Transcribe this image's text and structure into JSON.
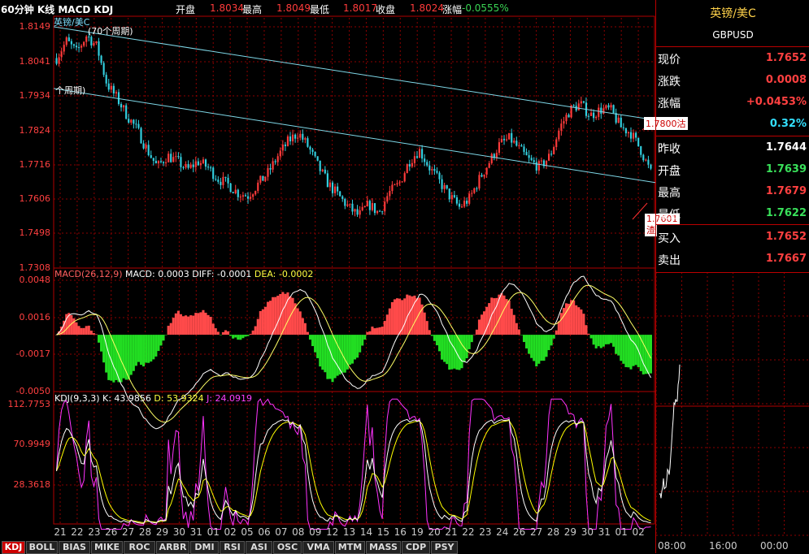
{
  "header": {
    "title": "60分钟 K线 MACD KDJ",
    "open_label": "开盘",
    "open_value": "1.8034",
    "high_label": "最高",
    "high_value": "1.8049",
    "low_label": "最低",
    "low_value": "1.8017",
    "close_label": "收盘",
    "close_value": "1.8024",
    "change_label": "涨幅",
    "change_value": "-0.0555%"
  },
  "right_panel": {
    "name": "英镑/美Ⅽ",
    "code": "GBPUSD",
    "rows": [
      {
        "label": "现价",
        "value": "1.7652",
        "color": "red"
      },
      {
        "label": "涨跌",
        "value": "0.0008",
        "color": "red"
      },
      {
        "label": "涨幅",
        "value": "+0.0453%",
        "color": "red"
      },
      {
        "label": "",
        "value": "0.32%",
        "color": "cyan"
      },
      {
        "label": "昨收",
        "value": "1.7644",
        "color": "white"
      },
      {
        "label": "开盘",
        "value": "1.7639",
        "color": "green"
      },
      {
        "label": "最高",
        "value": "1.7679",
        "color": "red"
      },
      {
        "label": "最低",
        "value": "1.7622",
        "color": "green"
      },
      {
        "label": "买入",
        "value": "1.7652",
        "color": "red"
      },
      {
        "label": "卖出",
        "value": "1.7667",
        "color": "red"
      }
    ],
    "time_axis": [
      "08:00",
      "16:00",
      "00:00"
    ]
  },
  "annotations": {
    "symbol_label": "英镑/美Ⅽ",
    "upper_trend_label": "(70个周期)",
    "lower_trend_label": "个周期)",
    "resistance_tag": "1.7800沽",
    "support_tag": "1.7601",
    "support_tag_suffix": "渣"
  },
  "macd": {
    "title": "MACD(26,12,9)",
    "macd": "MACD: 0.0003",
    "diff": "DIFF: -0.0001",
    "dea": "DEA: -0.0002"
  },
  "kdj": {
    "title": "KDJ(9,3,3)",
    "k": "K: 43.9856",
    "d": "D: 53.9324",
    "j": "J: 24.0919"
  },
  "tabs": [
    "KDJ",
    "BOLL",
    "BIAS",
    "MIKE",
    "ROC",
    "ARBR",
    "DMI",
    "RSI",
    "ASI",
    "OSC",
    "VMA",
    "MTM",
    "MASS",
    "CDP",
    "PSY"
  ],
  "active_tab": "KDJ",
  "colors": {
    "up": "#ff3b3b",
    "down": "#33d0e0",
    "grid": "#8b0000",
    "trend": "#7fd8e8",
    "macd_pos": "#ff4a4a",
    "macd_neg": "#22dd22",
    "kdj_k": "#ffffff",
    "kdj_d": "#ffff00",
    "kdj_j": "#ff33ff"
  },
  "chart_data": [
    {
      "type": "candlestick",
      "title": "60分钟 K线",
      "y_ticks": [
        "1.8149",
        "1.8041",
        "1.7934",
        "1.7824",
        "1.7716",
        "1.7606",
        "1.7498",
        "1.7308"
      ],
      "ylim": [
        1.7308,
        1.8149
      ],
      "x_ticks": [
        "21",
        "22",
        "23",
        "26",
        "27",
        "28",
        "29",
        "30",
        "31",
        "01",
        "02",
        "05",
        "06",
        "07",
        "08",
        "09",
        "12",
        "13",
        "14",
        "15",
        "16",
        "19",
        "20",
        "21",
        "22",
        "23",
        "24",
        "26",
        "27",
        "28",
        "29",
        "30",
        "31",
        "01",
        "02"
      ],
      "close_path": [
        1.804,
        1.81,
        1.806,
        1.812,
        1.808,
        1.795,
        1.79,
        1.784,
        1.779,
        1.772,
        1.766,
        1.77,
        1.768,
        1.765,
        1.768,
        1.766,
        1.762,
        1.76,
        1.757,
        1.756,
        1.76,
        1.764,
        1.77,
        1.775,
        1.778,
        1.773,
        1.766,
        1.76,
        1.756,
        1.752,
        1.749,
        1.753,
        1.75,
        1.757,
        1.76,
        1.768,
        1.772,
        1.766,
        1.761,
        1.756,
        1.752,
        1.755,
        1.762,
        1.768,
        1.774,
        1.776,
        1.772,
        1.768,
        1.766,
        1.77,
        1.78,
        1.786,
        1.788,
        1.784,
        1.786,
        1.786,
        1.78,
        1.778,
        1.772,
        1.764
      ],
      "trendlines": [
        {
          "name": "resistance",
          "from": [
            1.8149,
            0
          ],
          "to": [
            1.7824,
            1
          ]
        },
        {
          "name": "support",
          "from": [
            1.7934,
            0
          ],
          "to": [
            1.7606,
            1
          ]
        }
      ]
    },
    {
      "type": "bar",
      "title": "MACD(26,12,9)",
      "y_ticks": [
        "0.0048",
        "0.0016",
        "-0.0017",
        "-0.0050"
      ],
      "ylim": [
        -0.005,
        0.0048
      ]
    },
    {
      "type": "line",
      "title": "KDJ(9,3,3)",
      "y_ticks": [
        "112.7753",
        "70.9949",
        "28.3618"
      ],
      "ylim": [
        0,
        112.7753
      ]
    }
  ]
}
